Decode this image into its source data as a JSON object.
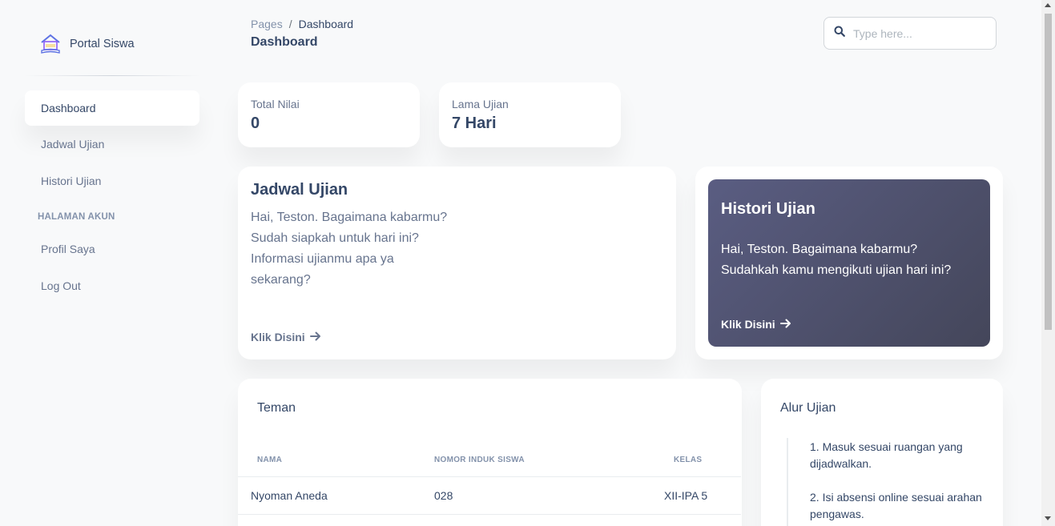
{
  "brand": {
    "name": "Portal Siswa",
    "logo": "school-house-book-icon"
  },
  "sidebar": {
    "items": [
      {
        "label": "Dashboard"
      },
      {
        "label": "Jadwal Ujian"
      },
      {
        "label": "Histori Ujian"
      }
    ],
    "section_label": "HALAMAN AKUN",
    "account_items": [
      {
        "label": "Profil Saya"
      },
      {
        "label": "Log Out"
      }
    ]
  },
  "header": {
    "breadcrumb_root": "Pages",
    "breadcrumb_sep": "/",
    "breadcrumb_current": "Dashboard",
    "title": "Dashboard",
    "search_placeholder": "Type here..."
  },
  "stats": [
    {
      "label": "Total Nilai",
      "value": "0"
    },
    {
      "label": "Lama Ujian",
      "value": "7 Hari"
    }
  ],
  "jadwal_card": {
    "title": "Jadwal Ujian",
    "text": "Hai, Teston. Bagaimana kabarmu? Sudah siapkah untuk hari ini? Informasi ujianmu apa ya sekarang?",
    "link": "Klik Disini"
  },
  "histori_card": {
    "title": "Histori Ujian",
    "text": "Hai, Teston. Bagaimana kabarmu? Sudahkah kamu mengikuti ujian hari ini?",
    "link": "Klik Disini"
  },
  "teman": {
    "title": "Teman",
    "columns": [
      "NAMA",
      "NOMOR INDUK SISWA",
      "KELAS"
    ],
    "rows": [
      {
        "nama": "Nyoman Aneda",
        "nis": "028",
        "kelas": "XII-IPA 5"
      }
    ]
  },
  "alur": {
    "title": "Alur Ujian",
    "steps": [
      "1. Masuk sesuai ruangan yang dijadwalkan.",
      "2. Isi absensi online sesuai arahan pengawas."
    ]
  },
  "colors": {
    "primary_text": "#344767",
    "muted_text": "#67748e",
    "gradient_start": "#5a5d82",
    "gradient_end": "#44465a"
  }
}
